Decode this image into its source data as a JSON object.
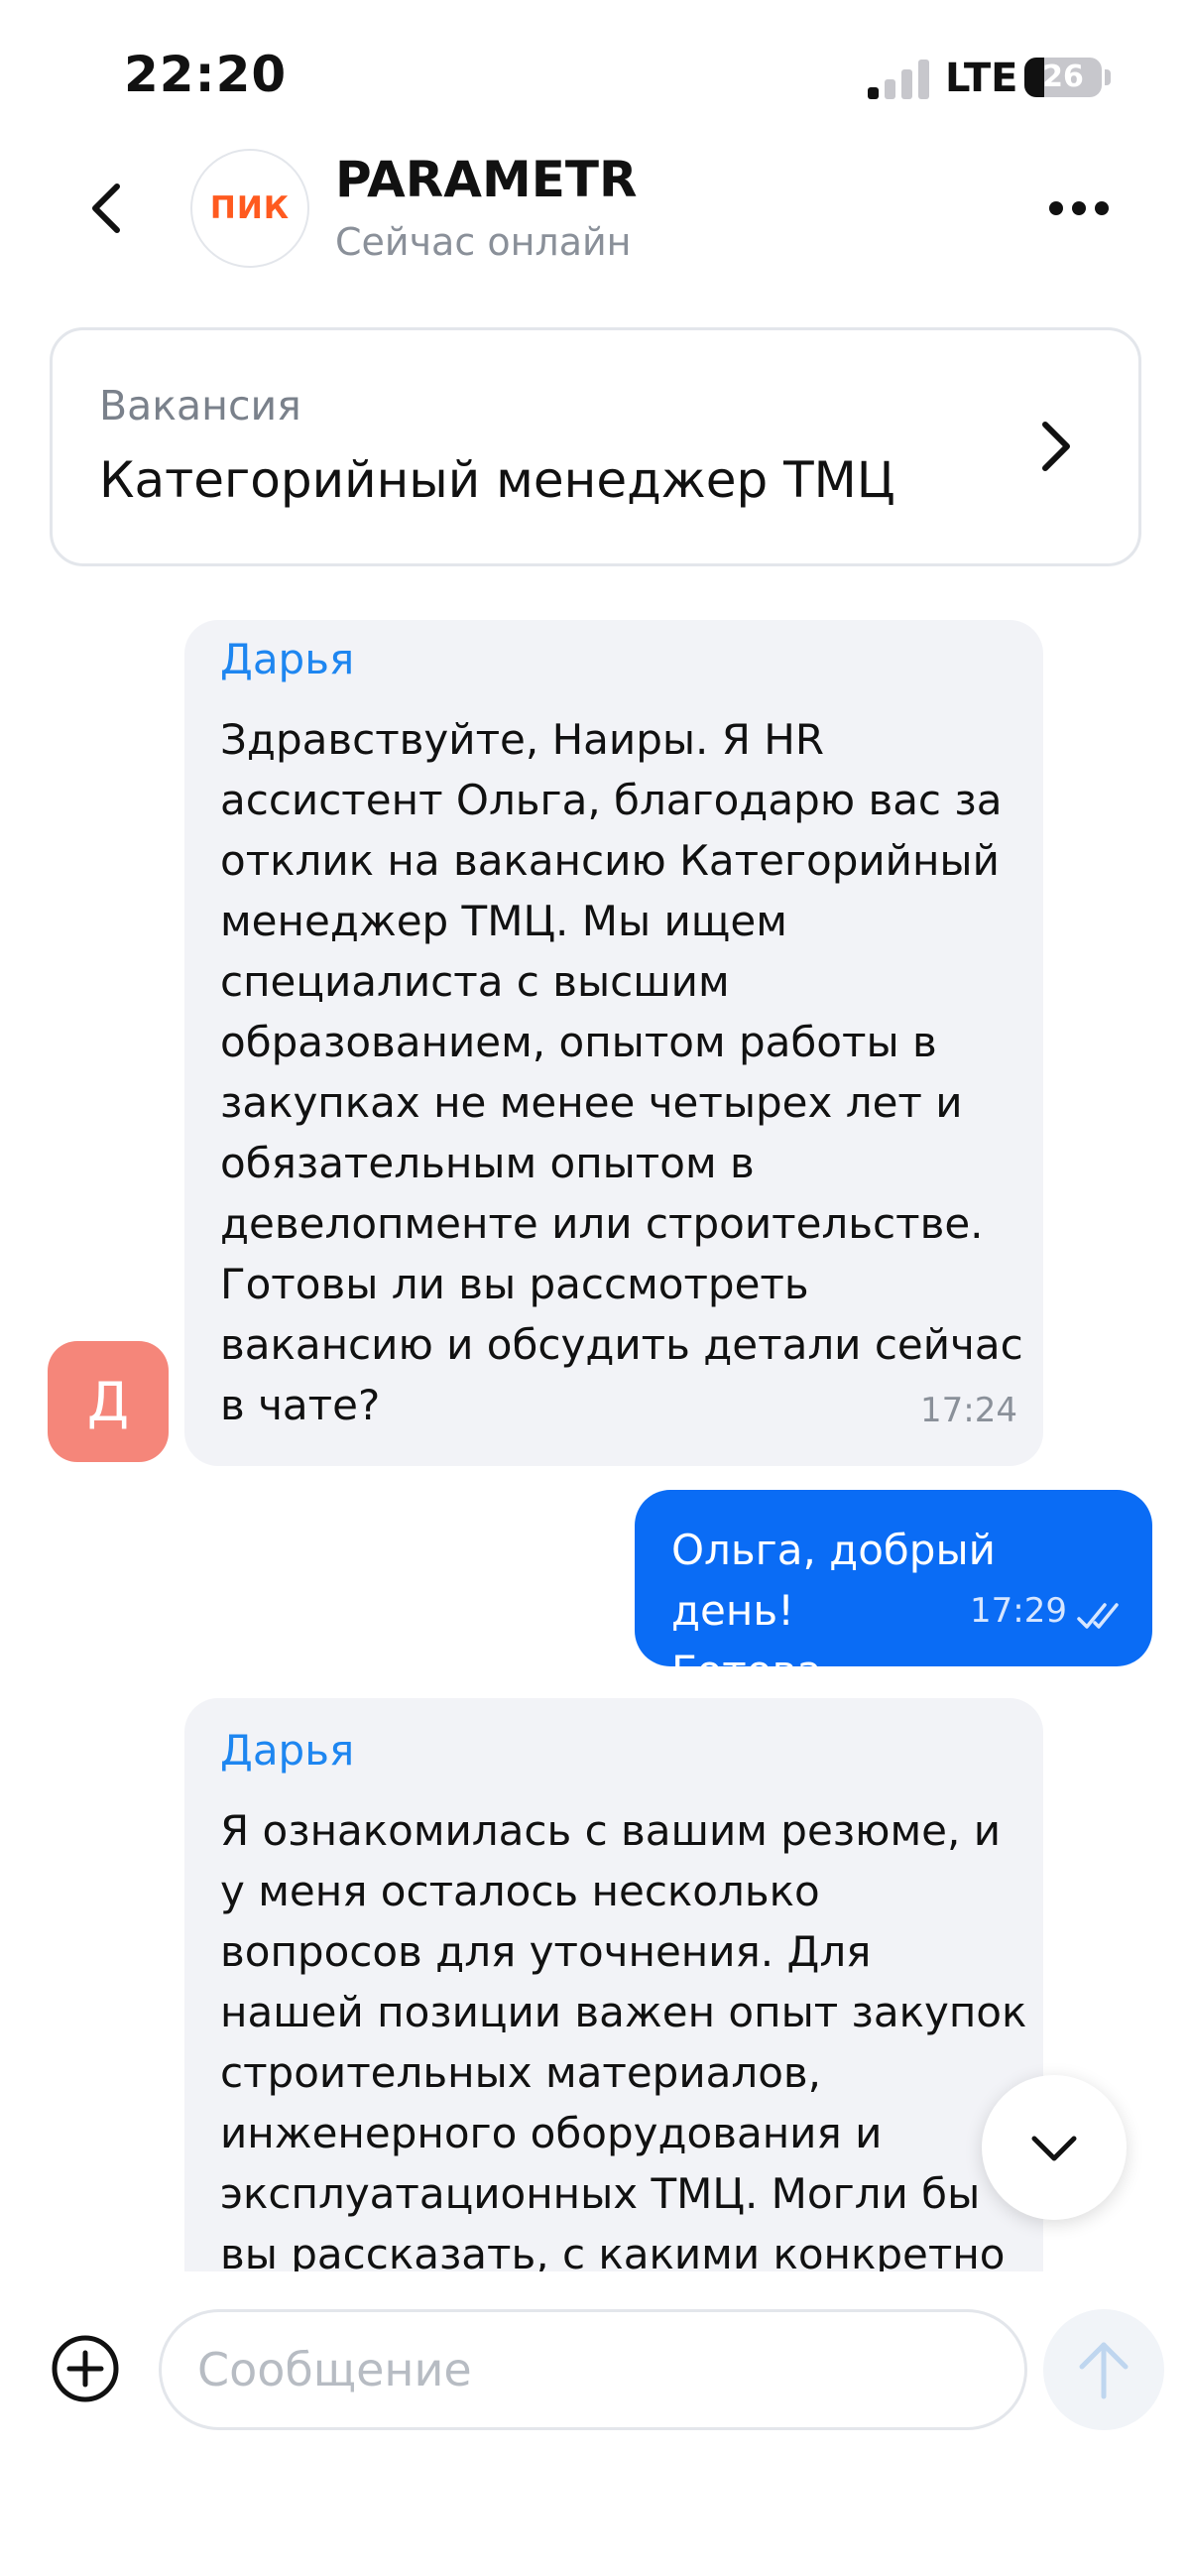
{
  "status_bar": {
    "time": "22:20",
    "network": "LTE",
    "battery": "26"
  },
  "header": {
    "logo_text": "ПИК",
    "title": "PARAMETR",
    "status": "Сейчас онлайн"
  },
  "vacancy": {
    "label": "Вакансия",
    "title": "Категорийный менеджер ТМЦ"
  },
  "messages": [
    {
      "sender": "Дарья",
      "avatar_letter": "Д",
      "text": "Здравствуйте, Наиры. Я HR\nассистент Ольга, благодарю вас за\nотклик на вакансию Категорийный\nменеджер ТМЦ. Мы ищем\nспециалиста с высшим\nобразованием, опытом работы в\nзакупках не менее четырех лет и\nобязательным опытом в\nдевелопменте или строительстве.\nГотовы ли вы рассмотреть\nвакансию и обсудить детали сейчас\nв чате?",
      "time": "17:24"
    },
    {
      "text": "Ольга, добрый день!\nГотова.",
      "time": "17:29"
    },
    {
      "sender": "Дарья",
      "text": "Я ознакомилась с вашим резюме, и\nу меня осталось несколько\nвопросов для уточнения. Для\nнашей позиции важен опыт закупок\nстроительных материалов,\nинженерного оборудования и\nэксплуатационных ТМЦ. Могли бы\nвы рассказать, с какими конкретно"
    }
  ],
  "composer": {
    "placeholder": "Сообщение"
  },
  "colors": {
    "accent": "#0a6cf5",
    "sender": "#1e86f0",
    "avatar": "#f5867a",
    "logo": "#ff5a1f"
  }
}
